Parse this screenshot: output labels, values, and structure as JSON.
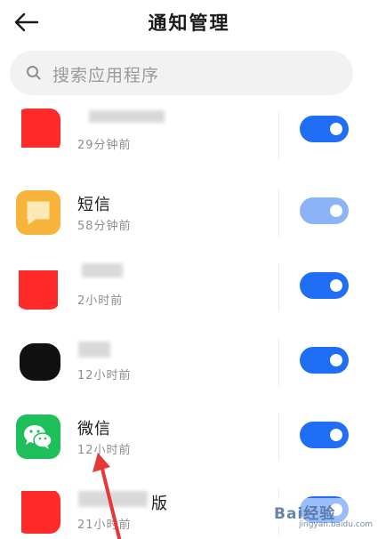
{
  "header": {
    "title": "通知管理",
    "back_icon": "arrow-left-icon"
  },
  "search": {
    "placeholder": "搜索应用程序",
    "icon": "search-icon"
  },
  "colors": {
    "toggle_on": "#1f6ef5",
    "toggle_disabled": "#8bb4f8",
    "annotation_arrow": "#e53935"
  },
  "apps": [
    {
      "name": "",
      "time": "29分钟前",
      "enabled": true,
      "icon": "redacted-app-icon"
    },
    {
      "name": "短信",
      "time": "58分钟前",
      "enabled": true,
      "dimmed": true,
      "icon": "sms-icon"
    },
    {
      "name": "",
      "time": "2小时前",
      "enabled": true,
      "icon": "redacted-app-icon"
    },
    {
      "name": "",
      "time": "12小时前",
      "enabled": true,
      "icon": "redacted-app-icon"
    },
    {
      "name": "微信",
      "time": "12小时前",
      "enabled": true,
      "icon": "wechat-icon"
    },
    {
      "name": "版",
      "time": "21小时前",
      "enabled": true,
      "icon": "redacted-app-icon"
    }
  ],
  "watermark": {
    "text": "Bai经验",
    "sub": "jingyan.baidu.com"
  }
}
